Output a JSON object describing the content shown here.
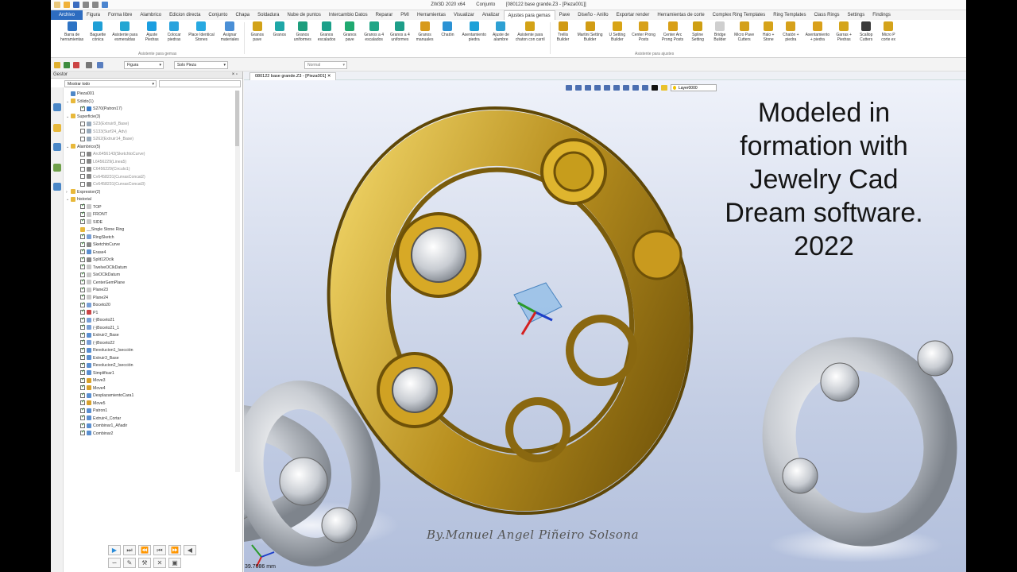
{
  "title_bar": {
    "app": "ZW3D 2020 x64",
    "mode": "Conjunto",
    "document": "[080122 base grande.Z3 - [Pieza001]]"
  },
  "menu_tabs": [
    "Archivo",
    "Figura",
    "Forma libre",
    "Alambrico",
    "Edicion directa",
    "Conjunto",
    "Chapa",
    "Soldadura",
    "Nube de puntos",
    "Intercambio Datos",
    "Reparar",
    "PMI",
    "Herramientas",
    "Visualizar",
    "Analizar",
    "Ajustes para gemas",
    "Pave",
    "Diseño - Anillo",
    "Exportar render",
    "Herramientas de corte",
    "Complex Ring Templates",
    "Ring Templates",
    "Class Rings",
    "Settings",
    "Findings"
  ],
  "active_tab": "Ajustes para gemas",
  "ribbon": {
    "buttons": [
      {
        "label": "Barra de\nherramientas",
        "icon": "toolbar-icon",
        "color": "#2d73c4"
      },
      {
        "label": "Baguette\ncónica",
        "icon": "baguette-icon",
        "color": "#1f9fd6"
      },
      {
        "label": "Asistente para\nesmeraldas",
        "icon": "emerald-icon",
        "color": "#24a6d3"
      },
      {
        "label": "Ajuste\nPiedras",
        "icon": "stone-icon",
        "color": "#1b9ee0"
      },
      {
        "label": "Colocar\npiedras",
        "icon": "place-stone-icon",
        "color": "#2aa3dd"
      },
      {
        "label": "Place Identical\nStones",
        "icon": "identical-stones-icon",
        "color": "#27a9e1"
      },
      {
        "label": "Asignar\nmateriales",
        "icon": "material-icon",
        "color": "#4a8fd6"
      },
      {
        "label": "Granos\npave",
        "icon": "pave-icon",
        "color": "#d2a218"
      },
      {
        "label": "Granos",
        "icon": "granos-icon",
        "color": "#1fa7a7"
      },
      {
        "label": "Granos\nuniformes",
        "icon": "granos-uniform-icon",
        "color": "#1e9e7d"
      },
      {
        "label": "Granos\nescalados",
        "icon": "granos-scaled-icon",
        "color": "#1ba08a"
      },
      {
        "label": "Granos\npave",
        "icon": "granos-pave-icon",
        "color": "#20a970"
      },
      {
        "label": "Granos a 4\nescalados",
        "icon": "granos4-scaled-icon",
        "color": "#21a686"
      },
      {
        "label": "Granos a 4\nuniformes",
        "icon": "granos4-uniform-icon",
        "color": "#1e9e89"
      },
      {
        "label": "Granos\nmanuales",
        "icon": "granos-manual-icon",
        "color": "#d79a1b"
      },
      {
        "label": "Chatón",
        "icon": "chaton-icon",
        "color": "#2b92d4"
      },
      {
        "label": "Asentamiento\npiedra",
        "icon": "seat-stone-icon",
        "color": "#1ea1d8"
      },
      {
        "label": "Ajuste de\nalambre",
        "icon": "wire-icon",
        "color": "#2da0d3"
      },
      {
        "label": "Asistente para\nchaton con carril",
        "icon": "chaton-rail-icon",
        "color": "#d3a216"
      },
      {
        "label": "Trellis\nBuilder",
        "icon": "trellis-icon",
        "color": "#d09a14"
      },
      {
        "label": "Martini Setting\nBuilder",
        "icon": "martini-icon",
        "color": "#d19c14"
      },
      {
        "label": "U Setting\nBuilder",
        "icon": "u-setting-icon",
        "color": "#d8a415"
      },
      {
        "label": "Center Prong\nPosts",
        "icon": "center-prong-icon",
        "color": "#d7a11a"
      },
      {
        "label": "Center Arc\nProng Posts",
        "icon": "arc-prong-icon",
        "color": "#d89f17"
      },
      {
        "label": "Spline\nSetting",
        "icon": "spline-icon",
        "color": "#cf9f13"
      },
      {
        "label": "Bridge\nBuilder",
        "icon": "bridge-icon",
        "color": "#cfcfcf"
      },
      {
        "label": "Micro Pave\nCutters",
        "icon": "micro-pave-icon",
        "color": "#d4a01b"
      },
      {
        "label": "Halo +\nStone",
        "icon": "halo-icon",
        "color": "#d6a31a"
      },
      {
        "label": "Chatón +\npiedra",
        "icon": "chaton-stone-icon",
        "color": "#d6a11b"
      },
      {
        "label": "Asentamiento\n+ piedra",
        "icon": "seat-plus-icon",
        "color": "#d9a01a"
      },
      {
        "label": "Garras +\nPiedras",
        "icon": "prongs-icon",
        "color": "#d4a51c"
      },
      {
        "label": "Scallop\nCutters",
        "icon": "scallop-icon",
        "color": "#3b3b3b"
      },
      {
        "label": "Micro P\ncorte ex",
        "icon": "micro-cut-icon",
        "color": "#d4a31b"
      }
    ],
    "groups": [
      "Asistente para gemas",
      "Asistente para ajustes"
    ]
  },
  "toolbar": {
    "filter_value": "Figura",
    "scope_value": "Solo Pieza",
    "render_value": "Normal"
  },
  "panel": {
    "title": "Gestor",
    "filter": "Mostrar todo"
  },
  "tree": [
    {
      "label": "Pieza001",
      "level": 0,
      "icon": "part",
      "check": null,
      "arrow": ""
    },
    {
      "label": "Sólido(1)",
      "level": 0,
      "icon": "folder",
      "check": null,
      "arrow": "v"
    },
    {
      "label": "S270(Patron17)",
      "level": 1,
      "icon": "solid",
      "check": true,
      "arrow": ""
    },
    {
      "label": "Superficie(3)",
      "level": 0,
      "icon": "folder",
      "check": null,
      "arrow": "v"
    },
    {
      "label": "S23(Extruir8_Base)",
      "level": 1,
      "icon": "surface",
      "check": false,
      "arrow": "",
      "dim": true
    },
    {
      "label": "S133(Surf24_Adv)",
      "level": 1,
      "icon": "surface",
      "check": false,
      "arrow": "",
      "dim": true
    },
    {
      "label": "S262(Extruir14_Base)",
      "level": 1,
      "icon": "surface",
      "check": false,
      "arrow": "",
      "dim": true
    },
    {
      "label": "Alambrico(5)",
      "level": 0,
      "icon": "folder",
      "check": null,
      "arrow": "v"
    },
    {
      "label": "Arc6456143(SketchtoCurve)",
      "level": 1,
      "icon": "curve",
      "check": false,
      "arrow": "",
      "dim": true
    },
    {
      "label": "L6456229(Linea5)",
      "level": 1,
      "icon": "curve",
      "check": false,
      "arrow": "",
      "dim": true
    },
    {
      "label": "C6456229(Circulo1)",
      "level": 1,
      "icon": "curve",
      "check": false,
      "arrow": "",
      "dim": true
    },
    {
      "label": "Cv6458231(CurvasConcat2)",
      "level": 1,
      "icon": "curve",
      "check": false,
      "arrow": "",
      "dim": true
    },
    {
      "label": "Cv6458231(CurvasConcat3)",
      "level": 1,
      "icon": "curve",
      "check": false,
      "arrow": "",
      "dim": true
    },
    {
      "label": "Expresion(2)",
      "level": 0,
      "icon": "folder",
      "check": null,
      "arrow": ">"
    },
    {
      "label": "historial",
      "level": 0,
      "icon": "folder",
      "check": null,
      "arrow": "v"
    },
    {
      "label": "TOP",
      "level": 1,
      "icon": "plane",
      "check": true,
      "arrow": ""
    },
    {
      "label": "FRONT",
      "level": 1,
      "icon": "plane",
      "check": true,
      "arrow": ""
    },
    {
      "label": "SIDE",
      "level": 1,
      "icon": "plane",
      "check": true,
      "arrow": ""
    },
    {
      "label": "__Single Stone Ring",
      "level": 1,
      "icon": "folder",
      "check": null,
      "arrow": ""
    },
    {
      "label": "RingSketch",
      "level": 1,
      "icon": "sketch",
      "check": true,
      "arrow": ""
    },
    {
      "label": "SketchtoCurve",
      "level": 1,
      "icon": "curve",
      "check": true,
      "arrow": ""
    },
    {
      "label": "Erase4",
      "level": 1,
      "icon": "feature",
      "check": true,
      "arrow": ""
    },
    {
      "label": "Split12Oclk",
      "level": 1,
      "icon": "curve",
      "check": true,
      "arrow": ""
    },
    {
      "label": "TwelveOClkDatum",
      "level": 1,
      "icon": "plane",
      "check": true,
      "arrow": ""
    },
    {
      "label": "SixOClkDatum",
      "level": 1,
      "icon": "plane",
      "check": true,
      "arrow": ""
    },
    {
      "label": "CenterGemPlane",
      "level": 1,
      "icon": "plane",
      "check": true,
      "arrow": ""
    },
    {
      "label": "Plane23",
      "level": 1,
      "icon": "plane",
      "check": true,
      "arrow": ""
    },
    {
      "label": "Plane24",
      "level": 1,
      "icon": "plane",
      "check": true,
      "arrow": ""
    },
    {
      "label": "Boceto20",
      "level": 1,
      "icon": "sketch",
      "check": true,
      "arrow": ""
    },
    {
      "label": "P1",
      "level": 1,
      "icon": "point",
      "check": true,
      "arrow": ""
    },
    {
      "label": "(-)Boceto21",
      "level": 1,
      "icon": "sketch",
      "check": true,
      "arrow": ""
    },
    {
      "label": "(-)Boceto21_1",
      "level": 1,
      "icon": "sketch",
      "check": true,
      "arrow": ""
    },
    {
      "label": "Extruir2_Base",
      "level": 1,
      "icon": "feature",
      "check": true,
      "arrow": ""
    },
    {
      "label": "(-)Boceto22",
      "level": 1,
      "icon": "sketch",
      "check": true,
      "arrow": ""
    },
    {
      "label": "Revolucion1_Isección",
      "level": 1,
      "icon": "feature",
      "check": true,
      "arrow": ""
    },
    {
      "label": "Extruir3_Base",
      "level": 1,
      "icon": "feature",
      "check": true,
      "arrow": ""
    },
    {
      "label": "Revolucion2_Isección",
      "level": 1,
      "icon": "feature",
      "check": true,
      "arrow": ""
    },
    {
      "label": "Simplificar1",
      "level": 1,
      "icon": "feature",
      "check": true,
      "arrow": ""
    },
    {
      "label": "Move3",
      "level": 1,
      "icon": "move",
      "check": true,
      "arrow": ""
    },
    {
      "label": "Move4",
      "level": 1,
      "icon": "move",
      "check": true,
      "arrow": ""
    },
    {
      "label": "DesplazamientoCara1",
      "level": 1,
      "icon": "feature",
      "check": true,
      "arrow": ""
    },
    {
      "label": "Move5",
      "level": 1,
      "icon": "move",
      "check": true,
      "arrow": ""
    },
    {
      "label": "Patron1",
      "level": 1,
      "icon": "feature",
      "check": true,
      "arrow": ""
    },
    {
      "label": "Extruir4_Cortar",
      "level": 1,
      "icon": "feature",
      "check": true,
      "arrow": ""
    },
    {
      "label": "Combinar1_Añadir",
      "level": 1,
      "icon": "feature",
      "check": true,
      "arrow": ""
    },
    {
      "label": "Combinar2",
      "level": 1,
      "icon": "feature",
      "check": true,
      "arrow": ""
    }
  ],
  "doc_tab": "080122 base grande.Z3 - [Pieza001]",
  "viewport": {
    "layer": "Layer0000",
    "overlay": [
      "Modeled in",
      "formation with",
      "Jewelry Cad",
      "Dream software.",
      "2022"
    ],
    "signature": "By.Manuel Angel Piñeiro Solsona",
    "coords": "39.7086 mm"
  }
}
